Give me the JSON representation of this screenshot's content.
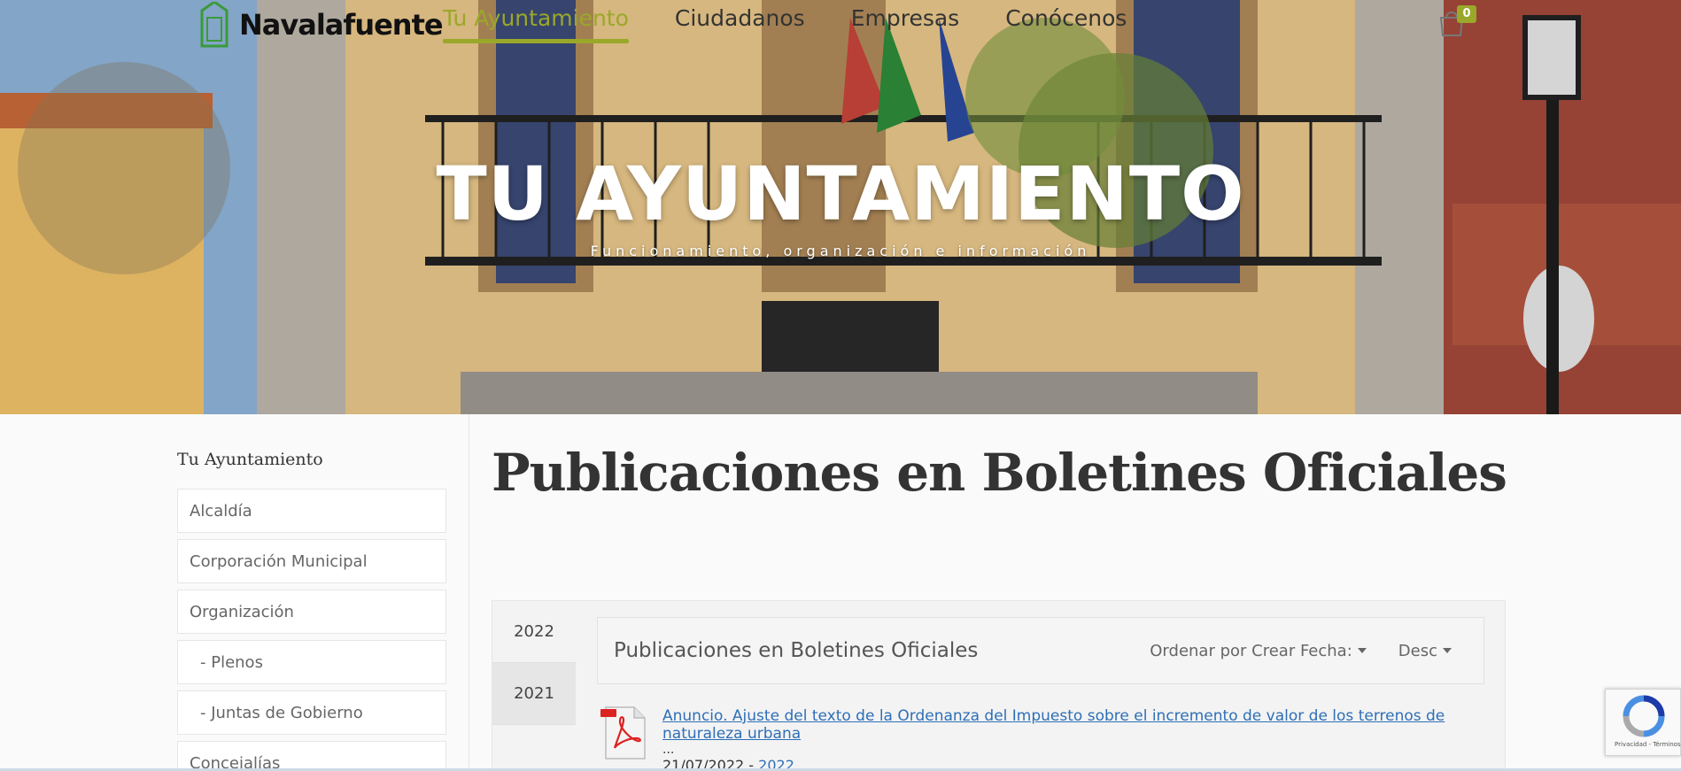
{
  "brand": {
    "name": "Navalafuente",
    "accent": "#9aa82a"
  },
  "nav": {
    "items": [
      {
        "label": "Tu Ayuntamiento",
        "active": true
      },
      {
        "label": "Ciudadanos",
        "active": false
      },
      {
        "label": "Empresas",
        "active": false
      },
      {
        "label": "Conócenos",
        "active": false
      }
    ],
    "cart_count": "0"
  },
  "hero": {
    "title": "TU AYUNTAMIENTO",
    "subtitle": "Funcionamiento, organización e información"
  },
  "sidebar": {
    "title": "Tu Ayuntamiento",
    "items": [
      {
        "label": "Alcaldía"
      },
      {
        "label": "Corporación Municipal"
      },
      {
        "label": "Organización"
      },
      {
        "label": "- Plenos"
      },
      {
        "label": "- Juntas de Gobierno"
      },
      {
        "label": "Concejalías"
      }
    ]
  },
  "main": {
    "page_title": "Publicaciones en Boletines Oficiales",
    "years": [
      "2022",
      "2021"
    ],
    "list_title": "Publicaciones en Boletines Oficiales",
    "sort_label": "Ordenar por Crear Fecha:",
    "order_label": "Desc",
    "documents": [
      {
        "title": "Anuncio. Ajuste del texto de la Ordenanza del Impuesto sobre el incremento de valor de los terrenos de naturaleza urbana",
        "ellipsis": "...",
        "date": "21/07/2022",
        "separator": " - ",
        "category": "2022"
      }
    ]
  },
  "recaptcha": {
    "text": "Privacidad - Términos"
  }
}
